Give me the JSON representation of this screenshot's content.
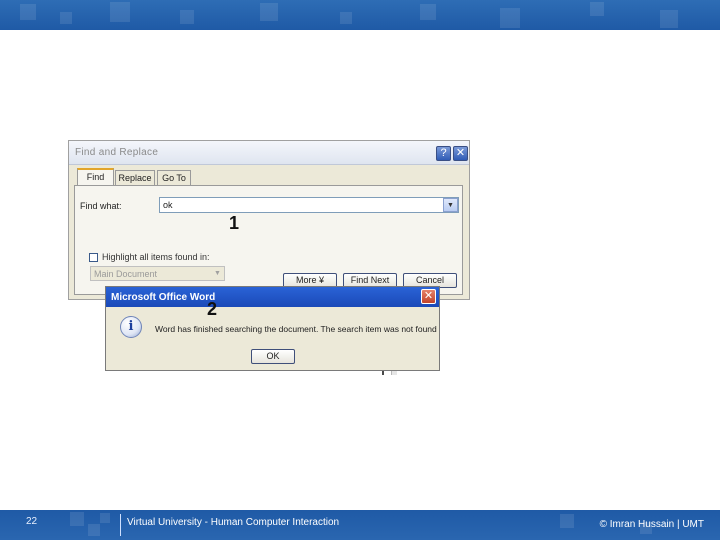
{
  "slide": {
    "number": "22",
    "footer_title": "Virtual University - Human Computer Interaction",
    "footer_copyright": "© Imran Hussain | UMT"
  },
  "find_replace_dialog": {
    "title": "Find and Replace",
    "help_label": "?",
    "close_label": "✕",
    "tabs": [
      "Find",
      "Replace",
      "Go To"
    ],
    "active_tab": "Find",
    "find_what_label": "Find what:",
    "find_what_value": "ok",
    "dropdown_glyph": "▼",
    "highlight_label": "Highlight all items found in:",
    "highlight_checked": false,
    "search_scope": "Main Document",
    "buttons": {
      "more": "More ¥",
      "find_next": "Find Next",
      "cancel": "Cancel"
    }
  },
  "annotations": {
    "one": "1",
    "two": "2"
  },
  "message_box": {
    "title": "Microsoft Office Word",
    "close_label": "✕",
    "icon": "info-icon",
    "icon_glyph": "i",
    "message": "Word has finished searching the document. The search item was not found",
    "ok_label": "OK"
  },
  "colors": {
    "banner_blue": "#1f5aa6",
    "dialog_face": "#ece9d8",
    "xp_title_blue": "#2a63d6"
  }
}
